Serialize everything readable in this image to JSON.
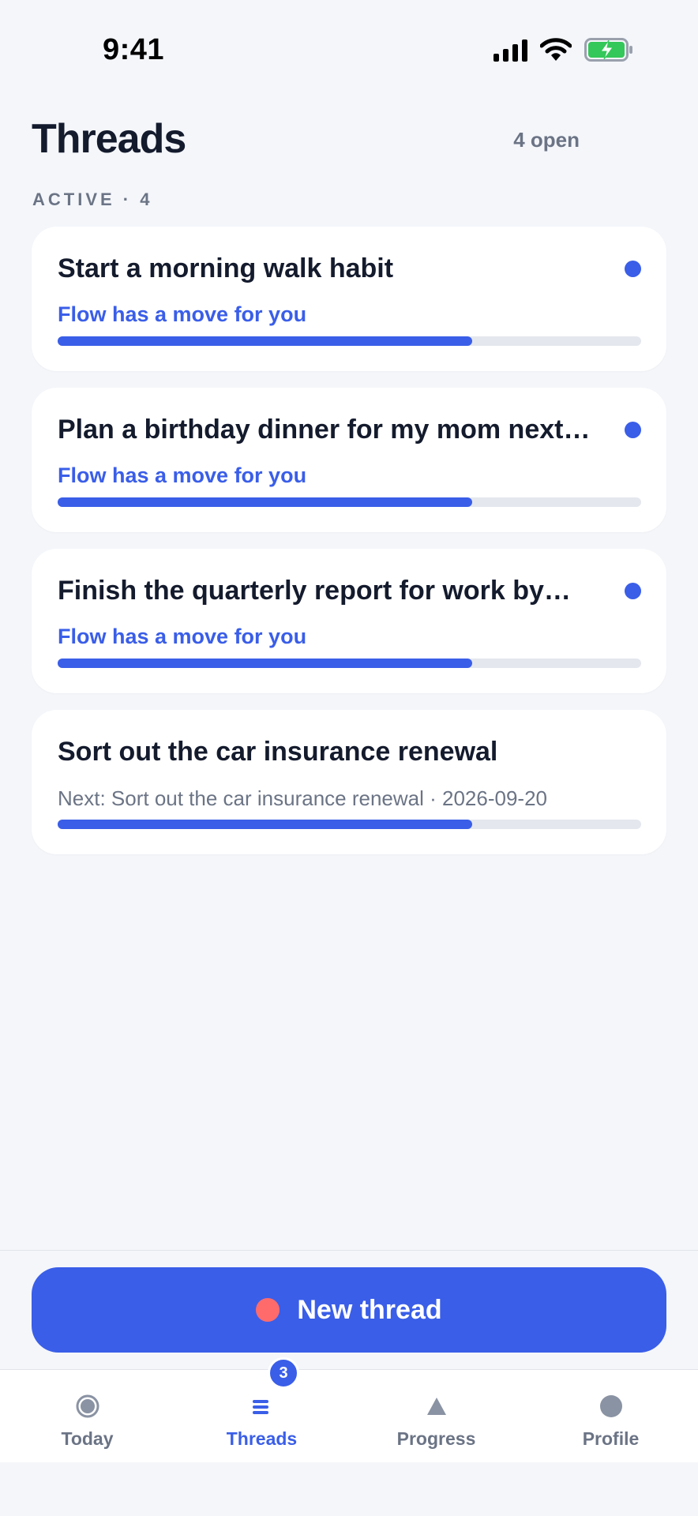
{
  "status_bar": {
    "time": "9:41"
  },
  "header": {
    "title": "Threads",
    "open_count": "4 open"
  },
  "section": {
    "label": "ACTIVE · 4"
  },
  "threads": [
    {
      "title": "Start a morning walk habit",
      "subtitle": "Flow has a move for you",
      "has_move": true,
      "progress": 0.71
    },
    {
      "title": "Plan a birthday dinner for my mom next…",
      "subtitle": "Flow has a move for you",
      "has_move": true,
      "progress": 0.71
    },
    {
      "title": "Finish the quarterly report for work by…",
      "subtitle": "Flow has a move for you",
      "has_move": true,
      "progress": 0.71
    },
    {
      "title": "Sort out the car insurance renewal",
      "subtitle": "Next: Sort out the car insurance renewal · 2026-09-20",
      "has_move": false,
      "progress": 0.71
    }
  ],
  "new_thread": {
    "label": "New thread"
  },
  "tabs": [
    {
      "label": "Today",
      "icon": "today-circle-icon",
      "active": false
    },
    {
      "label": "Threads",
      "icon": "threads-list-icon",
      "active": true,
      "badge": "3"
    },
    {
      "label": "Progress",
      "icon": "progress-triangle-icon",
      "active": false
    },
    {
      "label": "Profile",
      "icon": "profile-circle-icon",
      "active": false
    }
  ],
  "colors": {
    "accent": "#3a5ee8",
    "record_dot": "#ff6b6b",
    "background": "#f4f6fa",
    "muted": "#6b7485"
  }
}
